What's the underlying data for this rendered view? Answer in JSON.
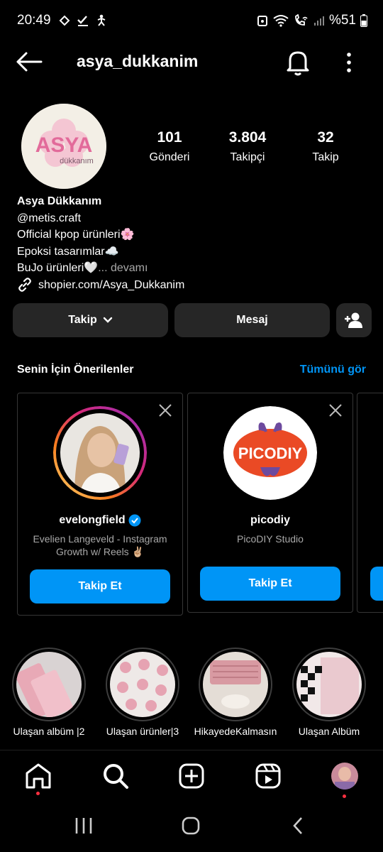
{
  "status_bar": {
    "time": "20:49",
    "battery": "%51"
  },
  "header": {
    "username": "asya_dukkanim"
  },
  "profile": {
    "avatar_text": "ASYA",
    "avatar_subtext": "dükkanım",
    "stats": [
      {
        "value": "101",
        "label": "Gönderi"
      },
      {
        "value": "3.804",
        "label": "Takipçi"
      },
      {
        "value": "32",
        "label": "Takip"
      }
    ],
    "name": "Asya Dükkanım",
    "handle": "@metis.craft",
    "bio_lines": [
      "Official kpop ürünleri🌸",
      "Epoksi tasarımlar☁️",
      "BuJo ürünleri🤍"
    ],
    "bio_more": "... devamı",
    "link": "shopier.com/Asya_Dukkanim"
  },
  "actions": {
    "follow": "Takip",
    "message": "Mesaj"
  },
  "suggestions": {
    "title": "Senin İçin Önerilenler",
    "see_all": "Tümünü gör",
    "cards": [
      {
        "username": "evelongfield",
        "subtitle": "Evelien Langeveld - Instagram Growth w/ Reels ✌🏼",
        "button": "Takip Et"
      },
      {
        "username": "picodiy",
        "subtitle": "PicoDIY Studio",
        "avatar_text": "PICODIY",
        "button": "Takip Et"
      }
    ]
  },
  "highlights": [
    {
      "label": "Ulaşan albüm |2"
    },
    {
      "label": "Ulaşan ürünler|3"
    },
    {
      "label": "HikayedeKalmasın"
    },
    {
      "label": "Ulaşan Albüm"
    }
  ],
  "colors": {
    "accent": "#0095f6",
    "button_grey": "#262626",
    "notification_dot": "#ff3040"
  }
}
